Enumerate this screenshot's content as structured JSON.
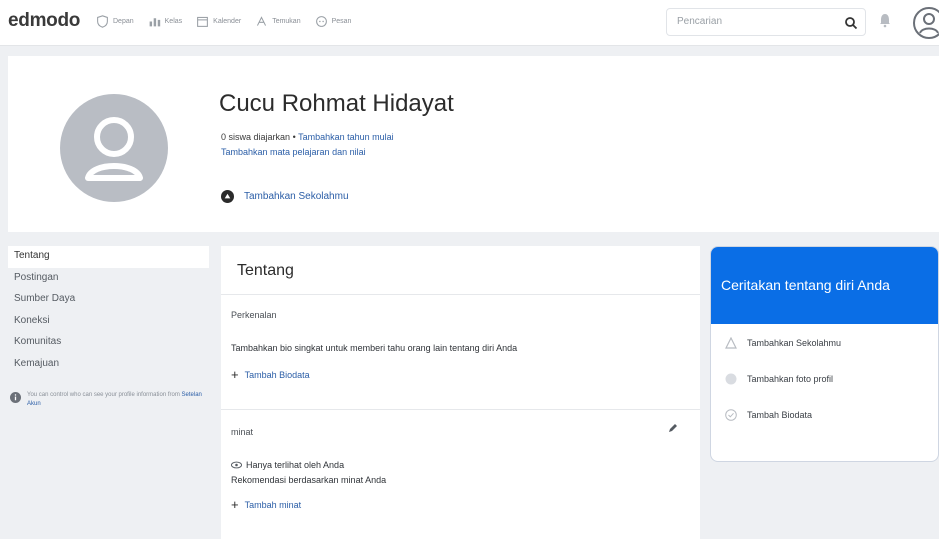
{
  "app": {
    "logo": "edmodo"
  },
  "nav": {
    "items": [
      {
        "label": "Depan",
        "icon": "shield-icon"
      },
      {
        "label": "Kelas",
        "icon": "classes-icon"
      },
      {
        "label": "Kalender",
        "icon": "calendar-icon"
      },
      {
        "label": "Temukan",
        "icon": "discover-icon"
      },
      {
        "label": "Pesan",
        "icon": "message-icon"
      }
    ]
  },
  "search": {
    "placeholder": "Pencarian"
  },
  "profile": {
    "name": "Cucu Rohmat Hidayat",
    "students": "0 siswa diajarkan",
    "separator": "•",
    "add_start_year": "Tambahkan tahun mulai",
    "add_subjects": "Tambahkan mata pelajaran dan nilai",
    "add_school": "Tambahkan Sekolahmu"
  },
  "sidebar": {
    "items": [
      {
        "label": "Tentang",
        "active": true
      },
      {
        "label": "Postingan"
      },
      {
        "label": "Sumber Daya"
      },
      {
        "label": "Koneksi"
      },
      {
        "label": "Komunitas"
      },
      {
        "label": "Kemajuan"
      }
    ],
    "note_text": "You can control who can see your profile information from",
    "note_link": "Setelan Akun"
  },
  "main": {
    "title": "Tentang",
    "intro_label": "Perkenalan",
    "intro_text": "Tambahkan bio singkat untuk memberi tahu orang lain tentang diri Anda",
    "add_bio": "Tambah Biodata",
    "interest_label": "minat",
    "visibility": "Hanya terlihat oleh Anda",
    "recommend": "Rekomendasi berdasarkan minat Anda",
    "add_interest": "Tambah minat"
  },
  "right_card": {
    "title": "Ceritakan tentang diri Anda",
    "items": [
      {
        "label": "Tambahkan Sekolahmu",
        "icon": "school-warning-icon"
      },
      {
        "label": "Tambahkan foto profil",
        "icon": "photo-icon"
      },
      {
        "label": "Tambah Biodata",
        "icon": "check-circle-icon"
      }
    ]
  },
  "colors": {
    "accent": "#0a6ee6",
    "link": "#2b5ea7"
  }
}
